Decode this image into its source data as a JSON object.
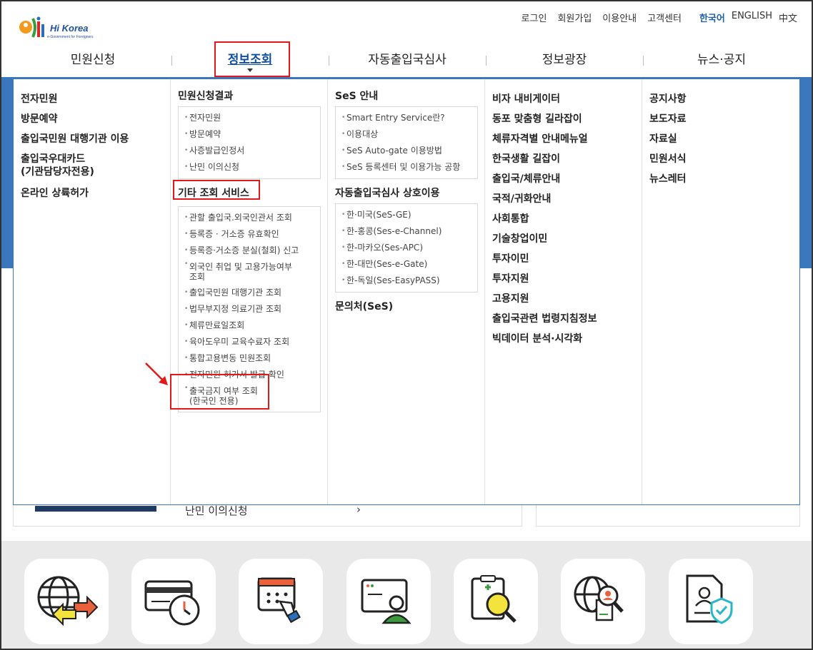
{
  "logo": {
    "brand": "Hi Korea",
    "tagline": "e-Government for Foreigners"
  },
  "util": {
    "links": [
      "로그인",
      "회원가입",
      "이용안내",
      "고객센터"
    ],
    "languages": [
      "한국어",
      "ENGLISH",
      "中文"
    ],
    "active_language": "한국어"
  },
  "gnb": [
    "민원신청",
    "정보조회",
    "자동출입국심사",
    "정보광장",
    "뉴스·공지"
  ],
  "gnb_active": "정보조회",
  "menu": {
    "col1": [
      "전자민원",
      "방문예약",
      "출입국민원 대행기관 이용",
      "출입국우대카드",
      "(기관담당자전용)",
      "온라인 상륙허가"
    ],
    "col2": {
      "section1_title": "민원신청결과",
      "section1_items": [
        "전자민원",
        "방문예약",
        "사증발급인정서",
        "난민 이의신청"
      ],
      "section2_title": "기타 조회 서비스",
      "section2_items": [
        "관할 출입국.외국인관서 조회",
        "등록증 · 거소증 유효확인",
        "등록증·거소증 분실(철회) 신고",
        "외국인 취업 및 고용가능여부",
        "조회",
        "출입국민원 대행기관 조회",
        "법무부지정 의료기관 조회",
        "체류만료일조회",
        "육아도우미 교육수료자 조회",
        "통합고용변동 민원조회",
        "전자민원 허가서 발급 확인",
        "출국금지 여부 조회",
        "(한국인 전용)"
      ]
    },
    "col3": {
      "section1_title": "SeS 안내",
      "section1_items": [
        "Smart Entry Service란?",
        "이용대상",
        "SeS Auto-gate 이용방법",
        "SeS 등록센터 및 이용가능 공항"
      ],
      "section2_title": "자동출입국심사 상호이용",
      "section2_items": [
        "한·미국(SeS-GE)",
        "한-홍콩(Ses-e-Channel)",
        "한-마카오(Ses-APC)",
        "한-대만(Ses-e-Gate)",
        "한-독일(Ses-EasyPASS)"
      ],
      "section3_title": "문의처(SeS)"
    },
    "col4": [
      "비자 내비게이터",
      "동포 맞춤형 길라잡이",
      "체류자격별 안내메뉴얼",
      "한국생활 길잡이",
      "출입국/체류안내",
      "국적/귀화안내",
      "사회통합",
      "기술창업이민",
      "투자이민",
      "투자지원",
      "고용지원",
      "출입국관련 법령지침정보",
      "빅데이터 분석·시각화"
    ],
    "col5": [
      "공지사항",
      "보도자료",
      "자료실",
      "민원서식",
      "뉴스레터"
    ]
  },
  "background": {
    "card_text": "난민 이의신청",
    "card_arrow": "›"
  },
  "colors": {
    "accent_blue": "#3b77bd",
    "annotation_red": "#e0191b",
    "active_text": "#0d4ea3"
  }
}
